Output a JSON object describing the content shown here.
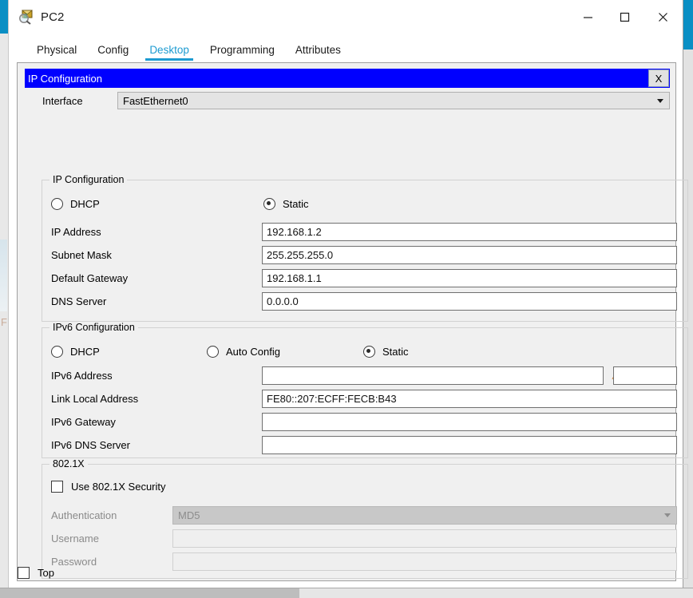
{
  "window": {
    "title": "PC2",
    "icon": "packet-tracer-pc-icon",
    "minimize_label": "—",
    "maximize_label": "□",
    "close_label": "✕"
  },
  "tabs": [
    {
      "label": "Physical",
      "active": false
    },
    {
      "label": "Config",
      "active": false
    },
    {
      "label": "Desktop",
      "active": true
    },
    {
      "label": "Programming",
      "active": false
    },
    {
      "label": "Attributes",
      "active": false
    }
  ],
  "panel": {
    "title": "IP Configuration",
    "close_label": "X",
    "title_bg": "#0000ff",
    "title_fg": "#ffffff"
  },
  "interface": {
    "label": "Interface",
    "value": "FastEthernet0"
  },
  "ipv4": {
    "group_title": "IP Configuration",
    "mode_dhcp": "DHCP",
    "mode_static": "Static",
    "selected_mode": "Static",
    "fields": [
      {
        "label": "IP Address",
        "value": "192.168.1.2"
      },
      {
        "label": "Subnet Mask",
        "value": "255.255.255.0"
      },
      {
        "label": "Default Gateway",
        "value": "192.168.1.1"
      },
      {
        "label": "DNS Server",
        "value": "0.0.0.0"
      }
    ]
  },
  "ipv6": {
    "group_title": "IPv6 Configuration",
    "mode_dhcp": "DHCP",
    "mode_auto": "Auto Config",
    "mode_static": "Static",
    "selected_mode": "Static",
    "address_label": "IPv6 Address",
    "address_value": "",
    "prefix_separator": "/",
    "prefix_value": "",
    "fields": [
      {
        "label": "Link Local Address",
        "value": "FE80::207:ECFF:FECB:B43"
      },
      {
        "label": "IPv6 Gateway",
        "value": ""
      },
      {
        "label": "IPv6 DNS Server",
        "value": ""
      }
    ]
  },
  "dot1x": {
    "group_title": "802.1X",
    "use_security_label": "Use 802.1X Security",
    "use_security_checked": false,
    "authentication_label": "Authentication",
    "authentication_value": "MD5",
    "username_label": "Username",
    "username_value": "",
    "password_label": "Password",
    "password_value": ""
  },
  "footer": {
    "top_label": "Top",
    "top_checked": false
  },
  "background": {
    "ghost_letter": "F"
  }
}
